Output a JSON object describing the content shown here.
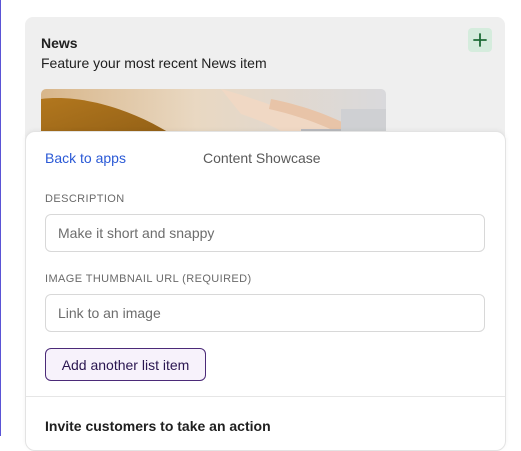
{
  "news": {
    "title": "News",
    "subtitle": "Feature your most recent News item",
    "add_icon": "plus-icon"
  },
  "panel": {
    "back_label": "Back to apps",
    "title": "Content Showcase",
    "description": {
      "label": "DESCRIPTION",
      "placeholder": "Make it short and snappy",
      "value": ""
    },
    "image_url": {
      "label": "IMAGE THUMBNAIL URL (REQUIRED)",
      "placeholder": "Link to an image",
      "value": ""
    },
    "add_item_label": "Add another list item",
    "next_section": "Invite customers to take an action"
  },
  "colors": {
    "link": "#2a59d6",
    "accent_border": "#4b2a78",
    "add_button_bg": "#d5ecdd",
    "card_bg": "#efefef"
  }
}
